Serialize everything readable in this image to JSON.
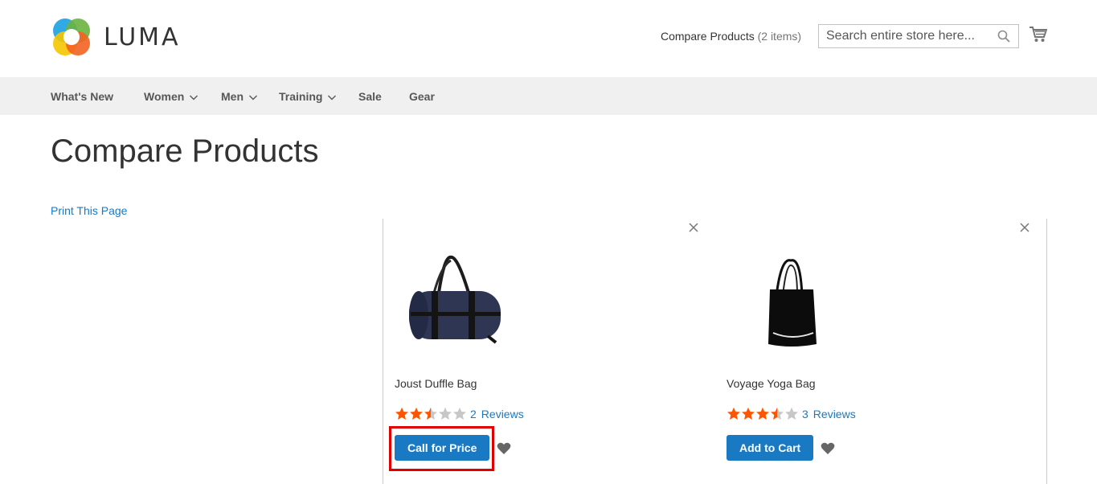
{
  "header": {
    "logo_text": "LUMA",
    "compare_label": "Compare Products",
    "compare_count": "(2 items)",
    "search_placeholder": "Search entire store here..."
  },
  "nav": {
    "items": [
      {
        "label": "What's New",
        "has_dropdown": false
      },
      {
        "label": "Women",
        "has_dropdown": true
      },
      {
        "label": "Men",
        "has_dropdown": true
      },
      {
        "label": "Training",
        "has_dropdown": true
      },
      {
        "label": "Sale",
        "has_dropdown": false
      },
      {
        "label": "Gear",
        "has_dropdown": false
      }
    ]
  },
  "main": {
    "title": "Compare Products",
    "print_label": "Print This Page",
    "products": [
      {
        "name": "Joust Duffle Bag",
        "rating_stars": 2.5,
        "review_count": "2",
        "reviews_label": "Reviews",
        "button_label": "Call for Price",
        "highlighted": true
      },
      {
        "name": "Voyage Yoga Bag",
        "rating_stars": 3.5,
        "review_count": "3",
        "reviews_label": "Reviews",
        "button_label": "Add to Cart",
        "highlighted": false
      }
    ]
  },
  "colors": {
    "accent": "#1979c3",
    "star_filled": "#ff5501",
    "star_empty": "#c7c7c7",
    "nav_bg": "#f0f0f0",
    "highlight": "#e00000"
  },
  "icons": [
    "luma-logo-icon",
    "search-icon",
    "cart-icon",
    "chevron-down-icon",
    "close-icon",
    "star-icon",
    "heart-icon"
  ]
}
